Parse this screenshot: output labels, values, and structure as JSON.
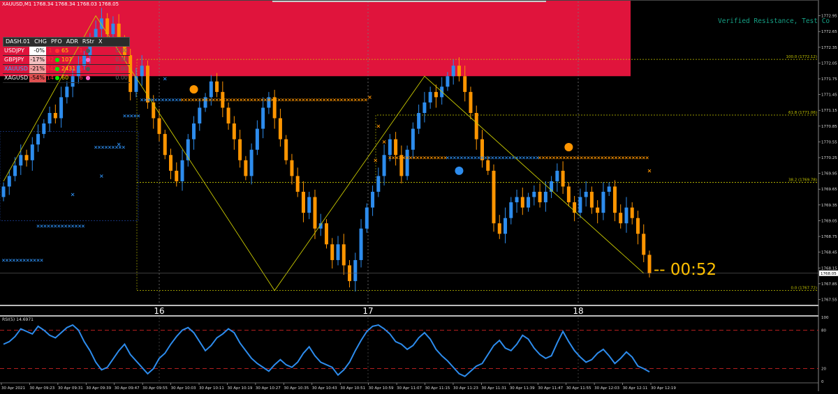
{
  "window": {
    "title": "XAUUSD,M1  1768.34 1768.34 1768.03 1768.05"
  },
  "annotation": {
    "verified": "Verified Resistance, Test Co"
  },
  "countdown": "--  00:52",
  "colors": {
    "bull": "#2d8ced",
    "bear": "#ff9500",
    "zone": "#e0143c",
    "fib": "#c8c800",
    "rsi": "#2d8ced",
    "rsi_level": "#cc2222"
  },
  "dashboard": {
    "headers": [
      "DASH.01",
      "CHG",
      "PFO",
      "ADR",
      "RStr",
      "X"
    ],
    "rows": [
      {
        "sym": "USDJPY",
        "chg": "-0%",
        "pfo": "1",
        "adr": "65",
        "rstr": "1",
        "val": "0.00",
        "pfo_color": "#ff3333",
        "dot": "#ff3333",
        "dot2": "#555555",
        "chg_bg": "#ffffff",
        "chg_fg": "#000000"
      },
      {
        "sym": "GBPJPY",
        "chg": "-17%",
        "pfo": "32",
        "adr": "107",
        "rstr": "5",
        "val": "0.00",
        "pfo_color": "#ff3333",
        "dot": "#00ee00",
        "dot2": "#ff66cc",
        "chg_bg": "#f4c0c0",
        "chg_fg": "#000000"
      },
      {
        "sym": "XAUUSD",
        "chg": "-21%",
        "pfo": "342",
        "adr": "2431",
        "rstr": "6",
        "val": "0.00",
        "pfo_color": "#ff3333",
        "dot": "#00ee00",
        "dot2": "#555555",
        "chg_bg": "#f09a9a",
        "chg_fg": "#000000"
      },
      {
        "sym": "XAGUSD",
        "chg": "-54%",
        "pfo": "14",
        "adr": "60",
        "rstr": "6",
        "val": "0.00",
        "pfo_color": "#ff3333",
        "dot": "#00ee00",
        "dot2": "#ff66cc",
        "chg_bg": "#e05050",
        "chg_fg": "#000000"
      }
    ]
  },
  "fib_labels": [
    "100.0 (1772.12)",
    "61.8 (1771.06)",
    "38.2 (1769.78)",
    "0.0 (1767.72)"
  ],
  "chart_data": {
    "type": "candlestick",
    "symbol": "XAUUSD,M1",
    "ylim": [
      1767.45,
      1773.25
    ],
    "y_ticks": [
      1767.55,
      1767.85,
      1768.15,
      1768.45,
      1768.75,
      1769.05,
      1769.35,
      1769.65,
      1769.95,
      1770.25,
      1770.55,
      1770.85,
      1771.15,
      1771.45,
      1771.75,
      1772.05,
      1772.35,
      1772.65,
      1772.95
    ],
    "y_tick_labels": [
      "1767.55",
      "1767.85",
      "1768.15",
      "1768.45",
      "1768.75",
      "1769.05",
      "1769.35",
      "1769.65",
      "1769.95",
      "1770.25",
      "1770.55",
      "1770.85",
      "1771.15",
      "1771.45",
      "1771.75",
      "1772.05",
      "1772.35",
      "1772.65",
      "1772.95"
    ],
    "last_price": 1768.05,
    "last_price_label": "1768.05",
    "day_labels": [
      "16",
      "17",
      "18"
    ],
    "day_label_index": [
      14,
      49,
      82
    ],
    "close": [
      1769.7,
      1769.9,
      1770.1,
      1770.3,
      1770.2,
      1770.5,
      1770.7,
      1770.9,
      1771.1,
      1771.0,
      1771.4,
      1771.6,
      1771.8,
      1772.0,
      1772.2,
      1772.5,
      1772.7,
      1772.9,
      1772.6,
      1772.8,
      1772.5,
      1772.2,
      1771.5,
      1771.8,
      1772.0,
      1771.3,
      1771.0,
      1770.7,
      1770.3,
      1770.0,
      1769.8,
      1770.2,
      1770.6,
      1770.9,
      1771.2,
      1771.4,
      1771.7,
      1771.5,
      1771.2,
      1770.9,
      1770.6,
      1770.2,
      1769.9,
      1770.4,
      1770.8,
      1771.2,
      1771.4,
      1771.0,
      1770.6,
      1770.2,
      1769.9,
      1769.6,
      1769.2,
      1769.5,
      1768.9,
      1769.0,
      1768.6,
      1768.3,
      1768.6,
      1768.2,
      1767.9,
      1768.3,
      1768.9,
      1769.3,
      1769.6,
      1769.9,
      1770.3,
      1770.6,
      1770.3,
      1769.9,
      1770.4,
      1770.8,
      1771.1,
      1771.3,
      1771.5,
      1771.4,
      1771.6,
      1771.8,
      1772.0,
      1771.8,
      1771.5,
      1771.1,
      1770.6,
      1770.2,
      1770.0,
      1769.0,
      1768.8,
      1769.1,
      1769.4,
      1769.5,
      1769.3,
      1769.5,
      1769.6,
      1769.4,
      1769.6,
      1769.8,
      1770.0,
      1769.7,
      1769.4,
      1769.2,
      1769.5,
      1769.6,
      1769.3,
      1769.2,
      1769.6,
      1769.7,
      1769.2,
      1769.0,
      1769.3,
      1769.1,
      1768.8,
      1768.4,
      1768.05
    ],
    "series": [
      {
        "name": "RSI(5) 14.6971",
        "values": [
          58,
          62,
          70,
          82,
          78,
          74,
          86,
          80,
          72,
          68,
          76,
          84,
          88,
          80,
          62,
          48,
          30,
          18,
          22,
          35,
          48,
          58,
          42,
          32,
          22,
          12,
          20,
          36,
          44,
          58,
          70,
          80,
          84,
          76,
          62,
          48,
          56,
          68,
          74,
          82,
          76,
          60,
          48,
          36,
          28,
          22,
          16,
          26,
          34,
          26,
          22,
          30,
          44,
          54,
          40,
          30,
          26,
          22,
          10,
          18,
          30,
          48,
          64,
          78,
          86,
          88,
          82,
          74,
          62,
          58,
          50,
          56,
          68,
          76,
          66,
          50,
          40,
          32,
          22,
          12,
          8,
          16,
          24,
          28,
          42,
          56,
          64,
          52,
          48,
          58,
          72,
          66,
          52,
          42,
          36,
          40,
          60,
          78,
          62,
          48,
          38,
          30,
          34,
          44,
          50,
          40,
          28,
          36,
          46,
          38,
          24,
          20,
          15
        ]
      }
    ],
    "rsi_label": "RSI(5) 14.6971",
    "rsi_ylim": [
      0,
      100
    ],
    "rsi_levels": [
      80,
      20
    ],
    "rsi_tick_labels": [
      "100",
      "80",
      "20",
      "0"
    ],
    "x_time_labels": [
      "30 Apr 2021",
      "30 Apr 09:23",
      "30 Apr 09:31",
      "30 Apr 09:39",
      "30 Apr 09:47",
      "30 Apr 09:55",
      "30 Apr 10:03",
      "30 Apr 10:11",
      "30 Apr 10:19",
      "30 Apr 10:27",
      "30 Apr 10:35",
      "30 Apr 10:43",
      "30 Apr 10:51",
      "30 Apr 10:59",
      "30 Apr 11:07",
      "30 Apr 11:15",
      "30 Apr 11:23",
      "30 Apr 11:31",
      "30 Apr 11:39",
      "30 Apr 11:47",
      "30 Apr 11:55",
      "30 Apr 12:03",
      "30 Apr 12:11",
      "30 Apr 12:19"
    ],
    "fib_levels": [
      1772.12,
      1771.06,
      1769.78,
      1767.72
    ],
    "resistance_zone": [
      1771.8,
      1773.25
    ],
    "zigzag": [
      {
        "i": 0,
        "p": 1769.8
      },
      {
        "i": 16,
        "p": 1772.95
      },
      {
        "i": 47,
        "p": 1767.72
      },
      {
        "i": 73,
        "p": 1771.8
      },
      {
        "i": 111,
        "p": 1768.05
      }
    ],
    "fractal_rows": [
      {
        "price": 1768.3,
        "from": 0,
        "to": 7,
        "color": "#2d8ced"
      },
      {
        "price": 1768.95,
        "from": 6,
        "to": 14,
        "color": "#2d8ced"
      },
      {
        "price": 1770.45,
        "from": 16,
        "to": 21,
        "color": "#2d8ced"
      },
      {
        "price": 1771.05,
        "from": 21,
        "to": 24,
        "color": "#2d8ced"
      },
      {
        "price": 1771.35,
        "from": 24,
        "to": 31,
        "color": "#2d8ced"
      },
      {
        "price": 1771.35,
        "from": 31,
        "to": 63,
        "color": "#ff9500"
      },
      {
        "price": 1770.25,
        "from": 67,
        "to": 77,
        "color": "#ff9500"
      },
      {
        "price": 1770.25,
        "from": 77,
        "to": 93,
        "color": "#2d8ced"
      },
      {
        "price": 1770.25,
        "from": 93,
        "to": 112,
        "color": "#ff9500"
      }
    ],
    "signal_dots": [
      {
        "i": 33,
        "p": 1771.55,
        "color": "#ff9500"
      },
      {
        "i": 79,
        "p": 1770.0,
        "color": "#2d8ced"
      },
      {
        "i": 98,
        "p": 1770.45,
        "color": "#ff9500"
      }
    ],
    "grid": true,
    "legend": "none"
  }
}
